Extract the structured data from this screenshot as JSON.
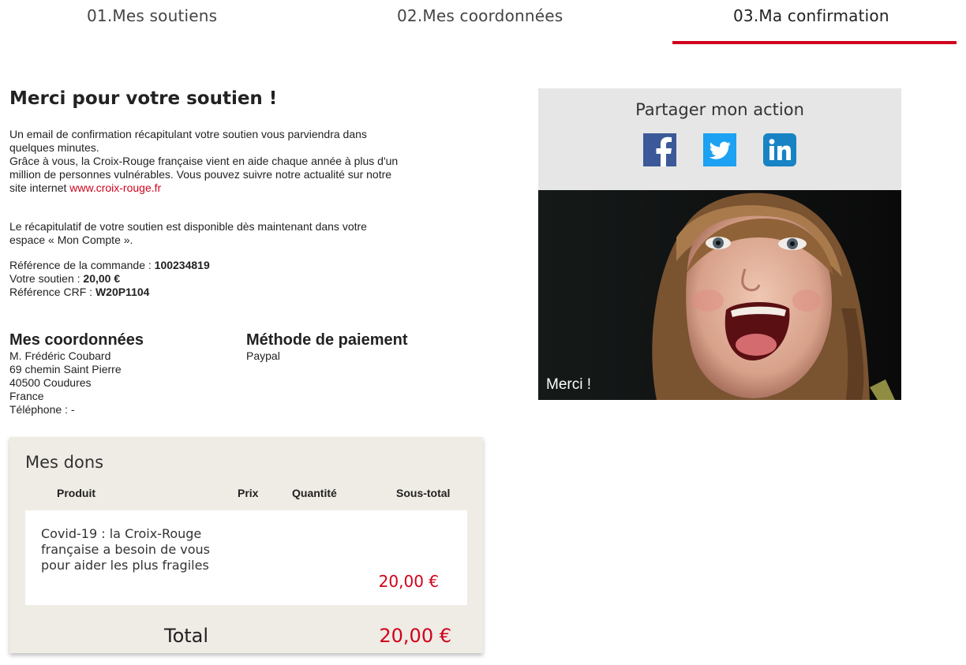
{
  "steps": [
    {
      "label": "01.Mes soutiens"
    },
    {
      "label": "02.Mes coordonnées"
    },
    {
      "label": "03.Ma confirmation",
      "active": true
    }
  ],
  "colors": {
    "accent": "#d0021b",
    "panel": "#efebe5",
    "share_bg": "#e6e6e6"
  },
  "confirmation": {
    "title": "Merci pour votre soutien !",
    "p1_a": "Un email de confirmation récapitulant votre soutien vous parviendra dans quelques minutes.",
    "p1_b": "Grâce à vous, la Croix-Rouge française vient en aide chaque année à plus d'un million de personnes vulnérables. Vous pouvez suivre notre actualité sur notre site internet ",
    "link": "www.croix-rouge.fr",
    "p2": "Le récapitulatif de votre soutien est disponible dès maintenant dans votre espace « Mon Compte ».",
    "ref_label": "Référence de la commande : ",
    "ref_value": "100234819",
    "soutien_label": "Votre soutien : ",
    "soutien_value": "20,00 €",
    "crf_label": "Référence CRF : ",
    "crf_value": "W20P1104"
  },
  "coordonnees": {
    "heading": "Mes coordonnées",
    "name": "M. Frédéric Coubard",
    "street": "69 chemin Saint Pierre",
    "city": "40500 Coudures",
    "country": "France",
    "phone": "Téléphone : -"
  },
  "paiement": {
    "heading": "Méthode de paiement",
    "method": "Paypal"
  },
  "dons": {
    "title": "Mes dons",
    "columns": {
      "produit": "Produit",
      "prix": "Prix",
      "quantite": "Quantité",
      "sous_total": "Sous-total"
    },
    "rows": [
      {
        "produit": "Covid-19 : la Croix-Rouge française a besoin de vous pour aider les plus fragiles",
        "prix": "",
        "quantite": "",
        "sous_total": "20,00 €"
      }
    ],
    "total_label": "Total",
    "total_value": "20,00 €"
  },
  "share": {
    "title": "Partager mon action",
    "icons": [
      "facebook-icon",
      "twitter-icon",
      "linkedin-icon"
    ]
  },
  "photo": {
    "caption": "Merci !"
  }
}
